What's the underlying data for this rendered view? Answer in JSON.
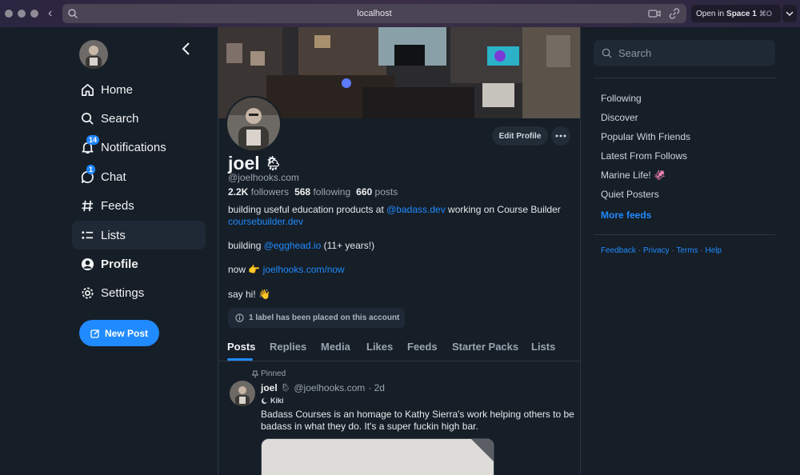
{
  "browser": {
    "url": "localhost",
    "open_in_prefix": "Open in",
    "open_in_target": "Space 1",
    "open_in_shortcut": "⌘O"
  },
  "nav": {
    "items": [
      {
        "label": "Home",
        "icon": "home-icon"
      },
      {
        "label": "Search",
        "icon": "search-icon"
      },
      {
        "label": "Notifications",
        "icon": "bell-icon",
        "badge": "14"
      },
      {
        "label": "Chat",
        "icon": "chat-icon",
        "badge": "1"
      },
      {
        "label": "Feeds",
        "icon": "hash-icon"
      },
      {
        "label": "Lists",
        "icon": "list-icon"
      },
      {
        "label": "Profile",
        "icon": "profile-icon"
      },
      {
        "label": "Settings",
        "icon": "gear-icon"
      }
    ],
    "new_post": "New Post"
  },
  "profile": {
    "edit_label": "Edit Profile",
    "name": "joel",
    "name_emoji": "🌦",
    "handle": "@joelhooks.com",
    "followers_count": "2.2K",
    "followers_label": "followers",
    "following_count": "568",
    "following_label": "following",
    "posts_count": "660",
    "posts_label": "posts",
    "bio_line1_a": "building useful education products at ",
    "bio_line1_link": "@badass.dev",
    "bio_line1_b": " working on Course Builder",
    "bio_line2_link": "coursebuilder.dev",
    "bio_line3_a": "building ",
    "bio_line3_link": "@egghead.io",
    "bio_line3_b": " (11+ years!)",
    "bio_line4_a": "now ",
    "bio_line4_emoji": "👉",
    "bio_line4_link": "joelhooks.com/now",
    "bio_line5": "say hi! 👋",
    "label_notice": "1 label has been placed on this account"
  },
  "tabs": [
    "Posts",
    "Replies",
    "Media",
    "Likes",
    "Feeds",
    "Starter Packs",
    "Lists"
  ],
  "post": {
    "pinned": "Pinned",
    "author": "joel",
    "author_emoji": "🌦",
    "handle": "@joelhooks.com",
    "time": "· 2d",
    "label": "Kiki",
    "text": "Badass Courses is an homage to Kathy Sierra's work helping others to be badass in what they do. It's a super fuckin high bar."
  },
  "right": {
    "search_placeholder": "Search",
    "feeds": [
      "Following",
      "Discover",
      "Popular With Friends",
      "Latest From Follows",
      "Marine Life! 🦑",
      "Quiet Posters"
    ],
    "more_feeds": "More feeds",
    "footer": [
      "Feedback",
      "Privacy",
      "Terms",
      "Help"
    ]
  },
  "colors": {
    "accent": "#208bfe",
    "background": "#161e27",
    "panel": "#1f2935"
  }
}
